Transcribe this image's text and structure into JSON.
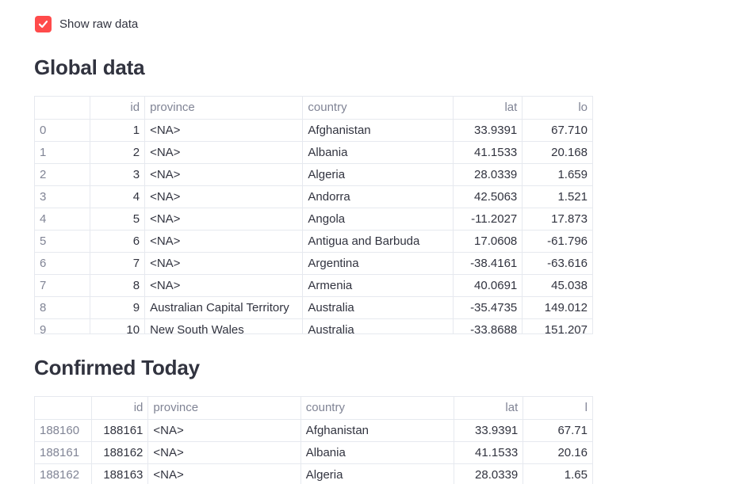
{
  "raw_toggle": {
    "label": "Show raw data",
    "checked": true,
    "accent": "#ff4b4b"
  },
  "global_section": {
    "title": "Global data",
    "columns": [
      "",
      "id",
      "province",
      "country",
      "lat",
      "lo"
    ],
    "rows": [
      [
        "0",
        "1",
        "<NA>",
        "Afghanistan",
        "33.9391",
        "67.710"
      ],
      [
        "1",
        "2",
        "<NA>",
        "Albania",
        "41.1533",
        "20.168"
      ],
      [
        "2",
        "3",
        "<NA>",
        "Algeria",
        "28.0339",
        "1.659"
      ],
      [
        "3",
        "4",
        "<NA>",
        "Andorra",
        "42.5063",
        "1.521"
      ],
      [
        "4",
        "5",
        "<NA>",
        "Angola",
        "-11.2027",
        "17.873"
      ],
      [
        "5",
        "6",
        "<NA>",
        "Antigua and Barbuda",
        "17.0608",
        "-61.796"
      ],
      [
        "6",
        "7",
        "<NA>",
        "Argentina",
        "-38.4161",
        "-63.616"
      ],
      [
        "7",
        "8",
        "<NA>",
        "Armenia",
        "40.0691",
        "45.038"
      ],
      [
        "8",
        "9",
        "Australian Capital Territory",
        "Australia",
        "-35.4735",
        "149.012"
      ],
      [
        "9",
        "10",
        "New South Wales",
        "Australia",
        "-33.8688",
        "151.207"
      ]
    ]
  },
  "confirmed_section": {
    "title": "Confirmed Today",
    "columns": [
      "",
      "id",
      "province",
      "country",
      "lat",
      "l"
    ],
    "rows": [
      [
        "188160",
        "188161",
        "<NA>",
        "Afghanistan",
        "33.9391",
        "67.71"
      ],
      [
        "188161",
        "188162",
        "<NA>",
        "Albania",
        "41.1533",
        "20.16"
      ],
      [
        "188162",
        "188163",
        "<NA>",
        "Algeria",
        "28.0339",
        "1.65"
      ]
    ]
  }
}
